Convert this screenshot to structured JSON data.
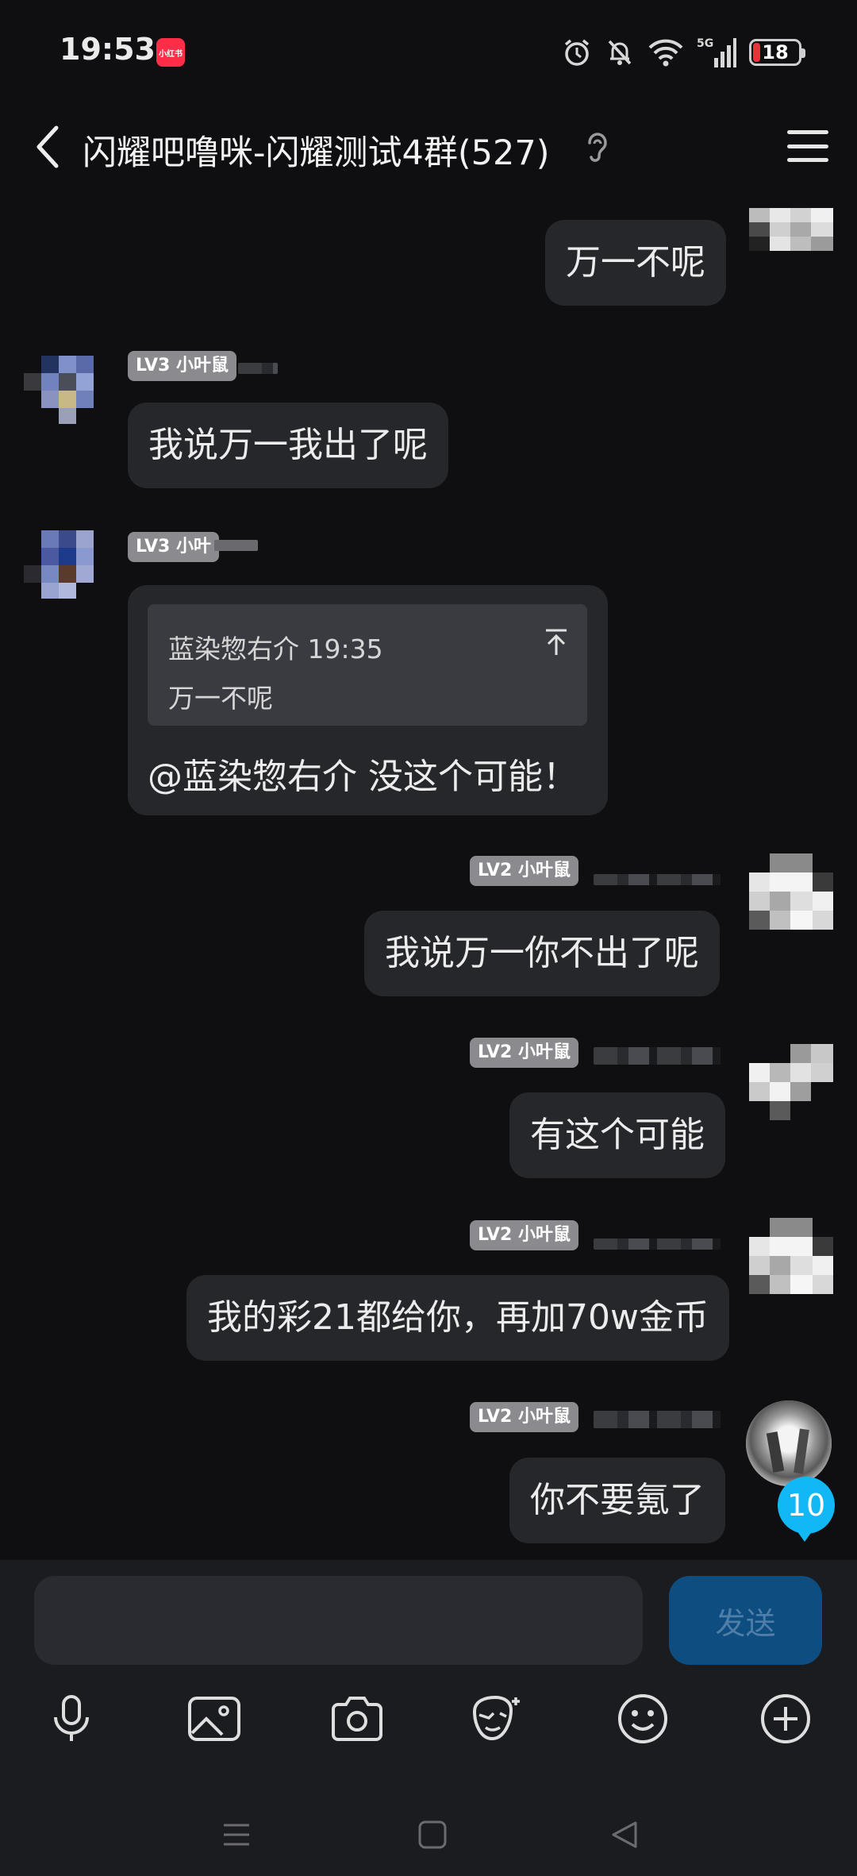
{
  "status_bar": {
    "time": "19:53",
    "app_badge": "小红书",
    "network": "5G",
    "battery": "18",
    "icons": [
      "alarm-icon",
      "mute-icon",
      "wifi-icon",
      "signal-icon",
      "battery-icon"
    ]
  },
  "header": {
    "title": "闪耀吧噜咪-闪耀测试4群(527)",
    "icons": [
      "back-icon",
      "ear-icon",
      "menu-icon"
    ]
  },
  "messages": [
    {
      "side": "right",
      "text": "万一不呢"
    },
    {
      "side": "left",
      "level": "LV3 小叶鼠",
      "text": "我说万一我出了呢"
    },
    {
      "side": "left",
      "level": "LV3 小叶",
      "quote": {
        "author_time": "蓝染惣右介 19:35",
        "text": "万一不呢"
      },
      "text": "@蓝染惣右介 没这个可能！"
    },
    {
      "side": "right",
      "level": "LV2 小叶鼠",
      "text": "我说万一你不出了呢"
    },
    {
      "side": "right",
      "level": "LV2 小叶鼠",
      "text": "有这个可能"
    },
    {
      "side": "right",
      "level": "LV2 小叶鼠",
      "text": "我的彩21都给你，再加70w金币"
    },
    {
      "side": "right",
      "level": "LV2 小叶鼠",
      "text": "你不要氪了"
    }
  ],
  "unread_count": "10",
  "composer": {
    "placeholder": "",
    "send_label": "发送",
    "tools": [
      "microphone-icon",
      "image-icon",
      "camera-icon",
      "face-effect-icon",
      "emoji-icon",
      "plus-icon"
    ]
  },
  "nav_bar": [
    "recents-icon",
    "home-icon",
    "back-triangle-icon"
  ],
  "colors": {
    "background": "#0f0f12",
    "bubble": "#26272b",
    "badge": "#8b8b8f",
    "send_button": "#0e4d80",
    "unread": "#12b7f5"
  }
}
